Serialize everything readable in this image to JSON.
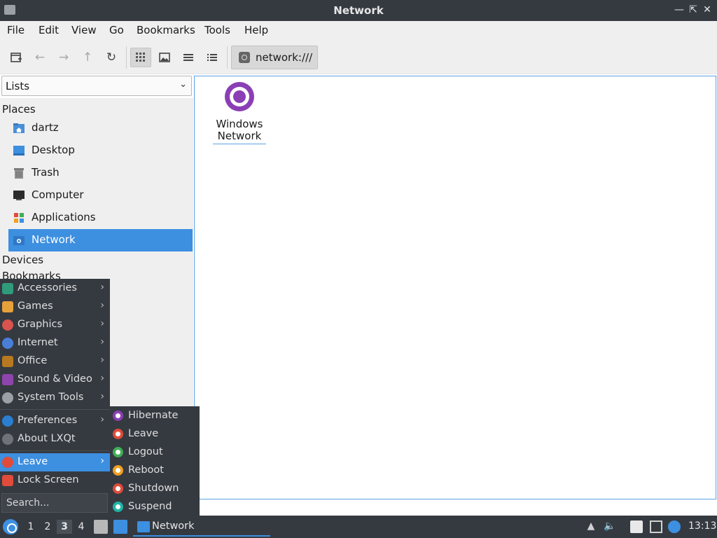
{
  "window": {
    "title": "Network"
  },
  "menubar": {
    "items": [
      "File",
      "Edit",
      "View",
      "Go",
      "Bookmarks",
      "Tools",
      "Help"
    ]
  },
  "toolbar": {
    "path": "network:///"
  },
  "sidepane": {
    "combo_value": "Lists",
    "places_heading": "Places",
    "places": [
      "dartz",
      "Desktop",
      "Trash",
      "Computer",
      "Applications",
      "Network"
    ],
    "selected_place": "Network",
    "devices_heading": "Devices",
    "bookmarks_heading": "Bookmarks"
  },
  "mainview": {
    "items": [
      {
        "label": "Windows Network"
      }
    ]
  },
  "appmenu": {
    "categories": [
      "Accessories",
      "Games",
      "Graphics",
      "Internet",
      "Office",
      "Sound & Video",
      "System Tools"
    ],
    "preferences": "Preferences",
    "about": "About LXQt",
    "leave": "Leave",
    "lock": "Lock Screen",
    "search_placeholder": "Search...",
    "icon_colors": [
      "#2f9b7a",
      "#e7a13a",
      "#d9534f",
      "#4a7fd8",
      "#b7791f",
      "#8e44ad",
      "#9aa0a6"
    ]
  },
  "leave_submenu": {
    "items": [
      "Hibernate",
      "Leave",
      "Logout",
      "Reboot",
      "Shutdown",
      "Suspend"
    ],
    "icon_colors": [
      "#8a3fb5",
      "#e04b3a",
      "#3fae55",
      "#f0a020",
      "#e04b3a",
      "#1fb5a8"
    ]
  },
  "panel": {
    "desktops": [
      "1",
      "2",
      "3",
      "4"
    ],
    "current_desktop": "3",
    "task_label": "Network",
    "clock": "13:13"
  }
}
